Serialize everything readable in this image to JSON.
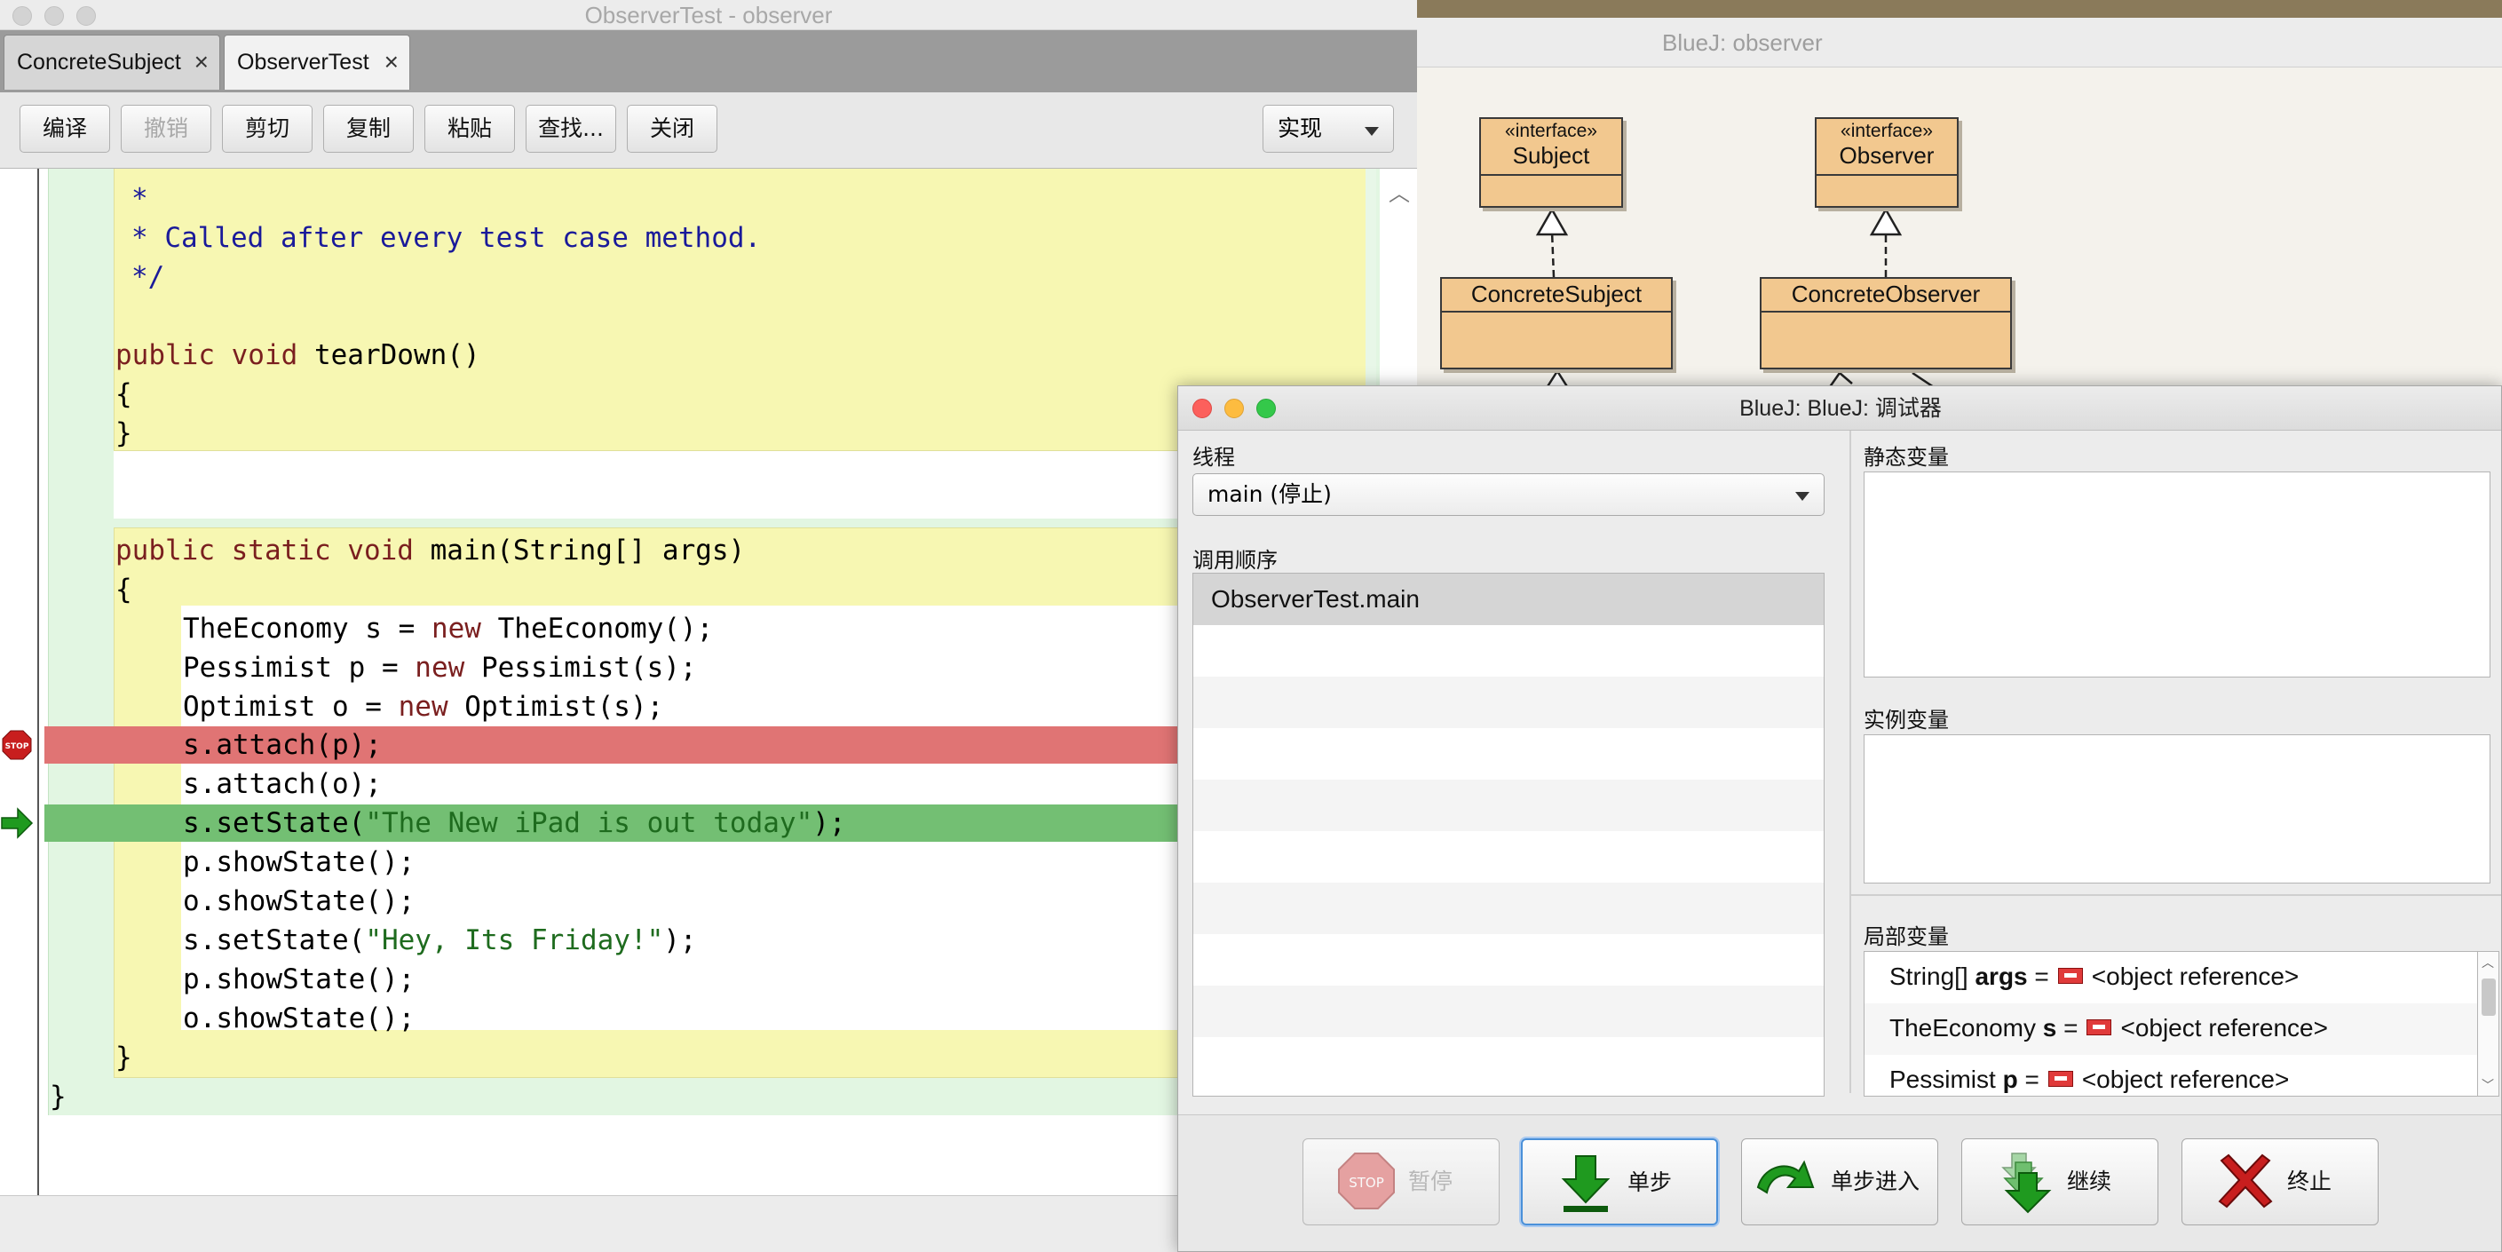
{
  "editor": {
    "window_title": "ObserverTest - observer",
    "tabs": [
      {
        "label": "ConcreteSubject",
        "close": "×"
      },
      {
        "label": "ObserverTest",
        "close": "×"
      }
    ],
    "toolbar": {
      "compile": "编译",
      "undo": "撤销",
      "cut": "剪切",
      "copy": "复制",
      "paste": "粘贴",
      "find": "查找...",
      "close": "关闭",
      "view_select": "实现"
    },
    "breakpoint_icon_label": "STOP"
  },
  "code_lines": [
    "*",
    "* Called after every test case method.",
    "*/",
    "public void tearDown()",
    "{",
    "}",
    "public static void main(String[] args)",
    "{",
    "TheEconomy s = new TheEconomy();",
    "Pessimist p = new Pessimist(s);",
    "Optimist o = new Optimist(s);",
    "s.attach(p);",
    "s.attach(o);",
    "s.setState(\"The New iPad is out today\");",
    "p.showState();",
    "o.showState();",
    "s.setState(\"Hey, Its Friday!\");",
    "p.showState();",
    "o.showState();",
    "}",
    "}"
  ],
  "diagram": {
    "window_title": "BlueJ:  observer",
    "classes": [
      {
        "stereotype": "«interface»",
        "name": "Subject"
      },
      {
        "stereotype": "«interface»",
        "name": "Observer"
      },
      {
        "name": "ConcreteSubject"
      },
      {
        "name": "ConcreteObserver"
      }
    ]
  },
  "debugger": {
    "window_title": "BlueJ:  BlueJ:  调试器",
    "thread_label": "线程",
    "thread_value": "main (停止)",
    "callstack_label": "调用顺序",
    "callstack": [
      "ObserverTest.main"
    ],
    "static_label": "静态变量",
    "instance_label": "实例变量",
    "local_label": "局部变量",
    "locals": [
      {
        "type": "String[]",
        "name": "args",
        "eq": "=",
        "value": "<object reference>"
      },
      {
        "type": "TheEconomy",
        "name": "s",
        "eq": "=",
        "value": "<object reference>"
      },
      {
        "type": "Pessimist",
        "name": "p",
        "eq": "=",
        "value": "<object reference>"
      }
    ],
    "buttons": {
      "halt": "暂停",
      "halt_icon_text": "STOP",
      "step": "单步",
      "step_into": "单步进入",
      "continue": "继续",
      "terminate": "终止"
    }
  },
  "colors": {
    "breakpoint_line": "#e07474",
    "current_line": "#73bf73",
    "method_band": "#f7f7b2",
    "class_band": "#e2f6e2",
    "uml_class_fill": "#f2c88f"
  }
}
